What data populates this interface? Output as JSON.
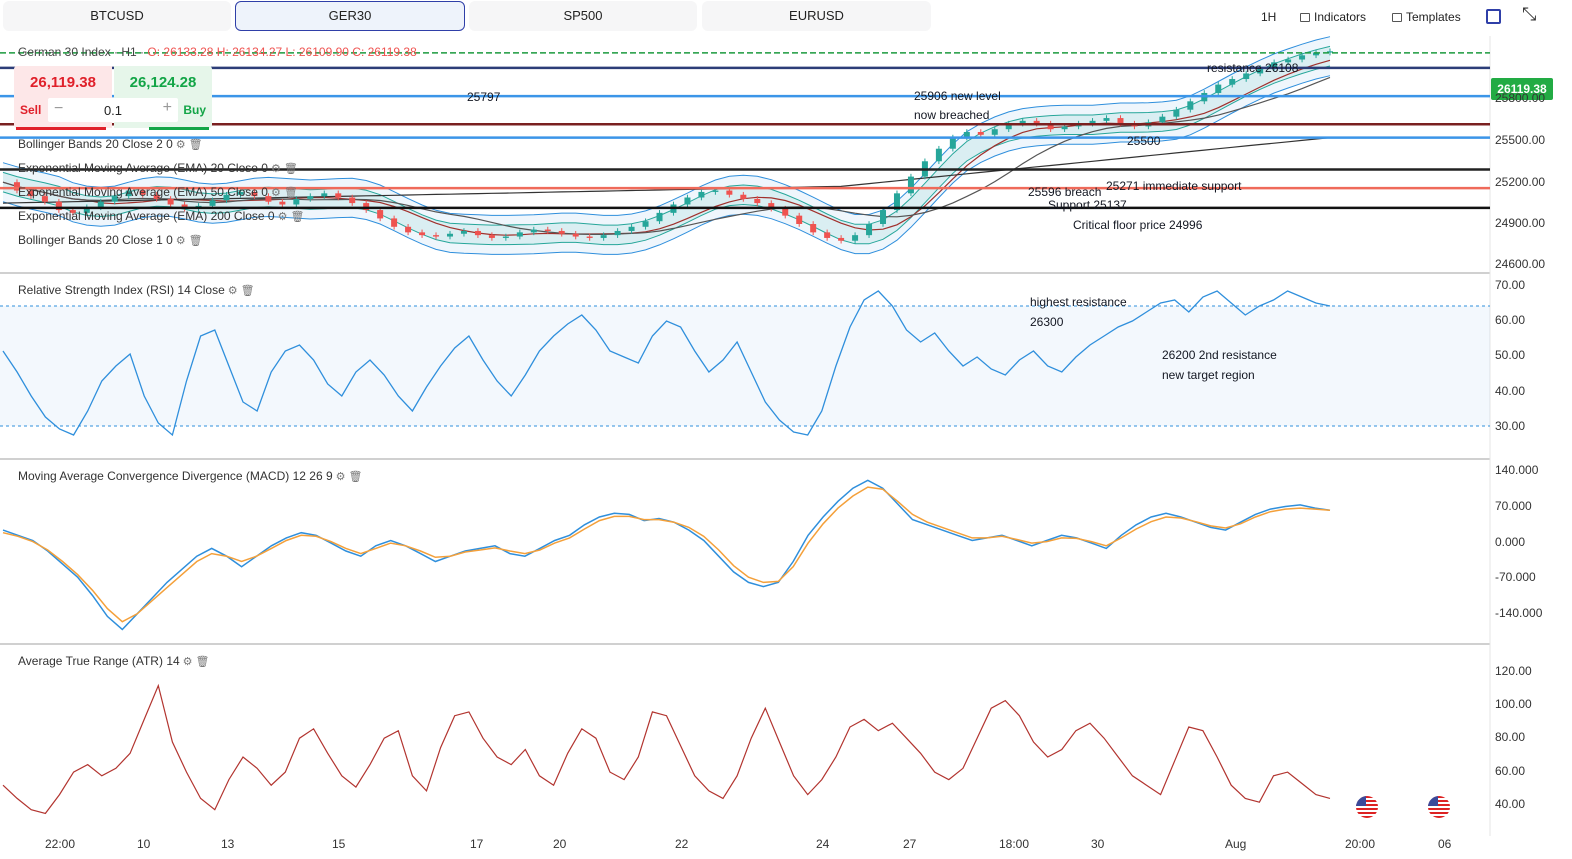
{
  "tabs": [
    {
      "label": "BTCUSD",
      "active": false
    },
    {
      "label": "GER30",
      "active": true
    },
    {
      "label": "SP500",
      "active": false
    },
    {
      "label": "EURUSD",
      "active": false
    }
  ],
  "toolbar": {
    "interval": "1H",
    "indicators_label": "Indicators",
    "templates_label": "Templates"
  },
  "legend": {
    "title": "German 30 Index · H1 · ",
    "open": "O: 26133.28",
    "high": "H: 26134.27",
    "low": "L: 26109.90",
    "close": "C: 26119.38"
  },
  "trade": {
    "sell_price": "26,119.38",
    "buy_price": "26,124.28",
    "sell_label": "Sell",
    "buy_label": "Buy",
    "quantity": "0.1",
    "minus": "−",
    "plus": "+"
  },
  "indicators": [
    {
      "name": "Bollinger Bands",
      "params": "20  Close  2  0"
    },
    {
      "name": "Exponential Moving Average (EMA)",
      "params": "20  Close  0"
    },
    {
      "name": "Exponential Moving Average (EMA)",
      "params": "50  Close  0"
    },
    {
      "name": "Exponential Moving Average (EMA)",
      "params": "200  Close  0"
    },
    {
      "name": "Bollinger Bands",
      "params": "20  Close  1  0"
    }
  ],
  "rsi_label": {
    "name": "Relative Strength Index (RSI)",
    "params": "14  Close"
  },
  "macd_label": {
    "name": "Moving Average Convergence Divergence (MACD)",
    "params": "12  26  9"
  },
  "atr_label": {
    "name": "Average True Range (ATR)",
    "params": "14"
  },
  "current_price": "26119.38",
  "annotations": {
    "a1": "resistance 26108",
    "a2": "25797",
    "a3": "25906 new level",
    "a4": "now breached",
    "a5": "25500",
    "a6": "25596 breach",
    "a7": "25271 immediate support",
    "a8": "Support 25137",
    "a9": "Critical floor price 24996",
    "a10": "highest resistance",
    "a11": "26300",
    "a12": "26200 2nd resistance",
    "a13": "new target region"
  },
  "price_axis": [
    "25800.00",
    "25500.00",
    "25200.00",
    "24900.00",
    "24600.00"
  ],
  "rsi_axis": [
    "70.00",
    "60.00",
    "50.00",
    "40.00",
    "30.00"
  ],
  "macd_axis": [
    "140.000",
    "70.000",
    "0.000",
    "-70.000",
    "-140.000"
  ],
  "atr_axis": [
    "120.00",
    "100.00",
    "80.00",
    "60.00",
    "40.00"
  ],
  "time_axis": [
    "22:00",
    "10",
    "13",
    "15",
    "17",
    "20",
    "22",
    "24",
    "27",
    "18:00",
    "30",
    "Aug",
    "20:00",
    "06"
  ],
  "colors": {
    "up": "#26a69a",
    "down": "#ef5350",
    "rsi": "#2f8fdc",
    "macd": "#2f8fdc",
    "signal": "#f4a03a",
    "atr": "#b2342f"
  },
  "chart_data": {
    "type": "candlestick",
    "instrument": "German 30 Index",
    "timeframe": "H1",
    "price_levels": [
      {
        "value": 26108,
        "color": "#1b9a3e",
        "style": "dashed"
      },
      {
        "value": 26000,
        "color": "#2c3d78"
      },
      {
        "value": 25797,
        "color": "#3b95e8"
      },
      {
        "value": 25596,
        "color": "#7a2020"
      },
      {
        "value": 25500,
        "color": "#3b95e8"
      },
      {
        "value": 25271,
        "color": "#222222"
      },
      {
        "value": 25137,
        "color": "#ef6a5a"
      },
      {
        "value": 24996,
        "color": "#111111"
      }
    ],
    "price_close": [
      25180,
      25120,
      25080,
      25040,
      24980,
      24960,
      25000,
      25040,
      25080,
      25120,
      25090,
      25060,
      25020,
      24990,
      25010,
      25050,
      25090,
      25110,
      25080,
      25040,
      25020,
      25060,
      25080,
      25100,
      25070,
      25030,
      24980,
      24920,
      24860,
      24820,
      24800,
      24790,
      24810,
      24830,
      24800,
      24780,
      24790,
      24820,
      24840,
      24830,
      24810,
      24790,
      24780,
      24800,
      24830,
      24860,
      24900,
      24960,
      25020,
      25070,
      25110,
      25120,
      25090,
      25060,
      25030,
      24990,
      24940,
      24880,
      24820,
      24780,
      24760,
      24800,
      24880,
      24980,
      25100,
      25220,
      25330,
      25420,
      25500,
      25540,
      25520,
      25560,
      25600,
      25620,
      25600,
      25560,
      25580,
      25600,
      25620,
      25640,
      25600,
      25580,
      25610,
      25650,
      25700,
      25760,
      25820,
      25880,
      25920,
      25960,
      26000,
      26040,
      26060,
      26090,
      26110,
      26119
    ],
    "rsi": [
      55,
      48,
      40,
      33,
      29,
      27,
      35,
      45,
      50,
      54,
      40,
      31,
      27,
      45,
      60,
      62,
      50,
      38,
      35,
      48,
      55,
      57,
      52,
      44,
      40,
      48,
      52,
      47,
      40,
      35,
      43,
      50,
      56,
      60,
      52,
      45,
      40,
      47,
      55,
      60,
      64,
      67,
      62,
      55,
      53,
      51,
      60,
      65,
      63,
      55,
      48,
      52,
      58,
      48,
      38,
      32,
      28,
      27,
      35,
      50,
      63,
      72,
      75,
      70,
      62,
      58,
      61,
      55,
      50,
      53,
      49,
      47,
      52,
      55,
      50,
      48,
      53,
      57,
      60,
      63,
      65,
      68,
      71,
      72,
      68,
      73,
      75,
      71,
      67,
      70,
      72,
      75,
      73,
      71,
      70
    ],
    "macd": [
      30,
      20,
      10,
      -10,
      -35,
      -60,
      -95,
      -135,
      -160,
      -130,
      -100,
      -70,
      -45,
      -20,
      -5,
      -20,
      -40,
      -20,
      0,
      15,
      25,
      20,
      5,
      -10,
      -20,
      0,
      10,
      0,
      -15,
      -30,
      -20,
      -10,
      -5,
      0,
      -15,
      -20,
      -5,
      10,
      20,
      40,
      55,
      62,
      60,
      48,
      52,
      45,
      30,
      10,
      -20,
      -50,
      -70,
      -78,
      -70,
      -30,
      20,
      55,
      85,
      110,
      125,
      110,
      80,
      50,
      40,
      30,
      20,
      10,
      15,
      20,
      10,
      0,
      10,
      20,
      15,
      5,
      -5,
      20,
      40,
      55,
      62,
      55,
      45,
      35,
      30,
      45,
      60,
      70,
      75,
      78,
      72,
      68
    ],
    "macd_signal": [
      25,
      18,
      8,
      -8,
      -30,
      -55,
      -85,
      -120,
      -145,
      -130,
      -105,
      -80,
      -55,
      -30,
      -15,
      -20,
      -30,
      -20,
      -5,
      10,
      20,
      18,
      8,
      -5,
      -15,
      -5,
      5,
      0,
      -10,
      -22,
      -20,
      -12,
      -8,
      -4,
      -10,
      -15,
      -8,
      5,
      15,
      32,
      48,
      56,
      56,
      50,
      50,
      45,
      35,
      18,
      -8,
      -38,
      -60,
      -70,
      -68,
      -40,
      5,
      42,
      72,
      95,
      112,
      108,
      85,
      60,
      45,
      35,
      25,
      15,
      15,
      18,
      12,
      5,
      8,
      15,
      14,
      8,
      0,
      15,
      32,
      46,
      55,
      53,
      46,
      38,
      34,
      42,
      55,
      65,
      70,
      72,
      70,
      68
    ],
    "atr": [
      55,
      48,
      42,
      40,
      50,
      62,
      66,
      60,
      64,
      72,
      90,
      108,
      78,
      62,
      48,
      42,
      58,
      70,
      64,
      55,
      62,
      80,
      85,
      72,
      60,
      54,
      66,
      80,
      84,
      60,
      52,
      75,
      92,
      94,
      80,
      70,
      66,
      74,
      60,
      55,
      72,
      85,
      80,
      62,
      58,
      70,
      94,
      92,
      76,
      60,
      52,
      48,
      60,
      80,
      96,
      78,
      60,
      50,
      58,
      70,
      86,
      90,
      84,
      88,
      80,
      72,
      62,
      58,
      64,
      80,
      96,
      100,
      92,
      78,
      70,
      74,
      84,
      88,
      80,
      70,
      60,
      55,
      50,
      68,
      86,
      84,
      70,
      55,
      48,
      46,
      60,
      62,
      56,
      50,
      48
    ],
    "y_range": [
      24550,
      26200
    ],
    "rsi_range": [
      20,
      80
    ],
    "macd_range": [
      -180,
      160
    ],
    "atr_range": [
      28,
      128
    ]
  }
}
